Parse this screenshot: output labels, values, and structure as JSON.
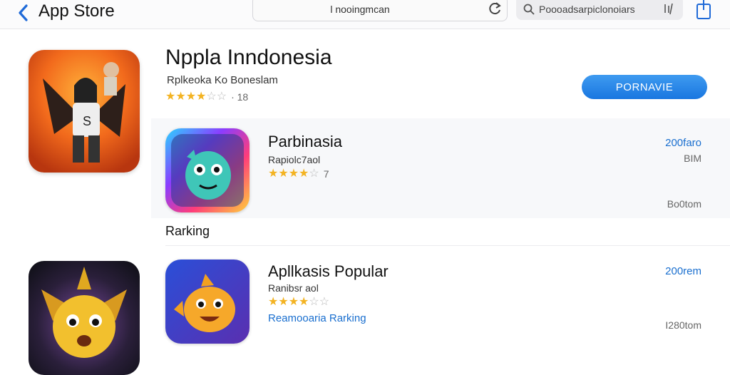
{
  "topbar": {
    "title": "App Store",
    "url": "l nooingmcan",
    "search": "Poooadsarpiclonoiars"
  },
  "featured": {
    "title": "Nppla Inndonesia",
    "subtitle": "Rplkeoka Ko Boneslam",
    "rating_stars": 3.5,
    "rating_count": "· 18",
    "button_label": "PORNAVIE"
  },
  "section_label": "Rarking",
  "list": [
    {
      "title": "Parbinasia",
      "subtitle": "Rapiolc7aol",
      "rating_stars": 3.5,
      "rating_count": "7",
      "price": "200faro",
      "meta_top": "BIM",
      "meta_bottom": "Bo0tom"
    },
    {
      "title": "Apllkasis Popular",
      "subtitle": "Ranibsr aol",
      "rating_stars": 4,
      "link": "Reamooaria Rarking",
      "price": "200rem",
      "meta_bottom": "I280tom"
    }
  ],
  "colors": {
    "accent": "#1a6fcf",
    "button": "#2f8ae8",
    "star": "#f3b322"
  }
}
